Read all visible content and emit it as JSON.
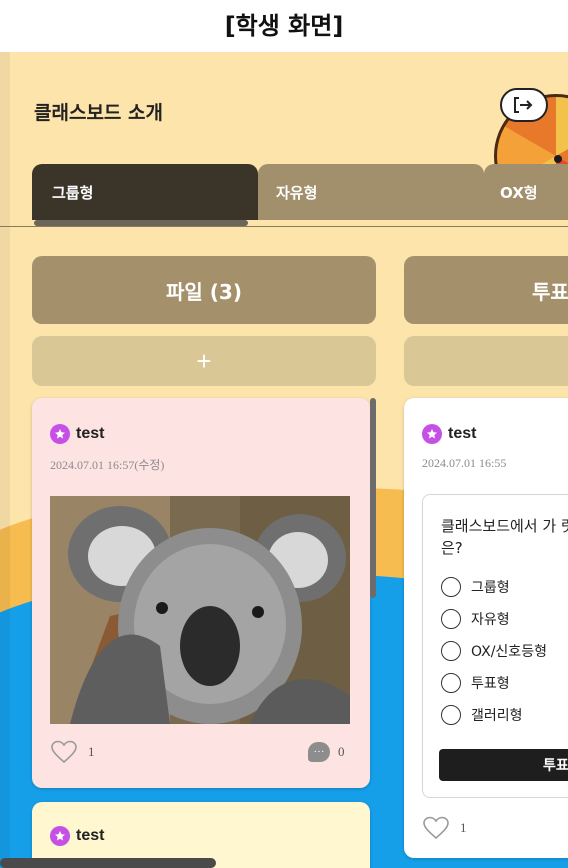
{
  "caption": "[학생 화면]",
  "board": {
    "title": "클래스보드 소개",
    "logout_icon": "logout-icon"
  },
  "tabs": [
    {
      "label": "그룹형",
      "active": true
    },
    {
      "label": "자유형",
      "active": false
    },
    {
      "label": "OX형",
      "active": false
    }
  ],
  "columns": [
    {
      "header": "파일 (3)",
      "add_label": "+"
    },
    {
      "header": "투표",
      "add_label": "+"
    }
  ],
  "cards": {
    "file_card": {
      "author": "test",
      "date": "2024.07.01 16:57(수정)",
      "likes": "1",
      "comments": "0",
      "image": "koala photo"
    },
    "poll_card": {
      "author": "test",
      "date": "2024.07.01 16:55",
      "question": "클래스보드에서 가 릿은?",
      "options": [
        "그룹형",
        "자유형",
        "OX/신호등형",
        "투표형",
        "갤러리형"
      ],
      "vote_label": "투표",
      "likes": "1"
    },
    "third_card": {
      "author": "test"
    }
  },
  "colors": {
    "background": "#fde4ab",
    "tab_active": "#3a3429",
    "tab_inactive": "#a28f6c",
    "avatar": "#c650e6",
    "file_card_bg": "#fde3e2",
    "third_card_bg": "#fff7d0"
  }
}
